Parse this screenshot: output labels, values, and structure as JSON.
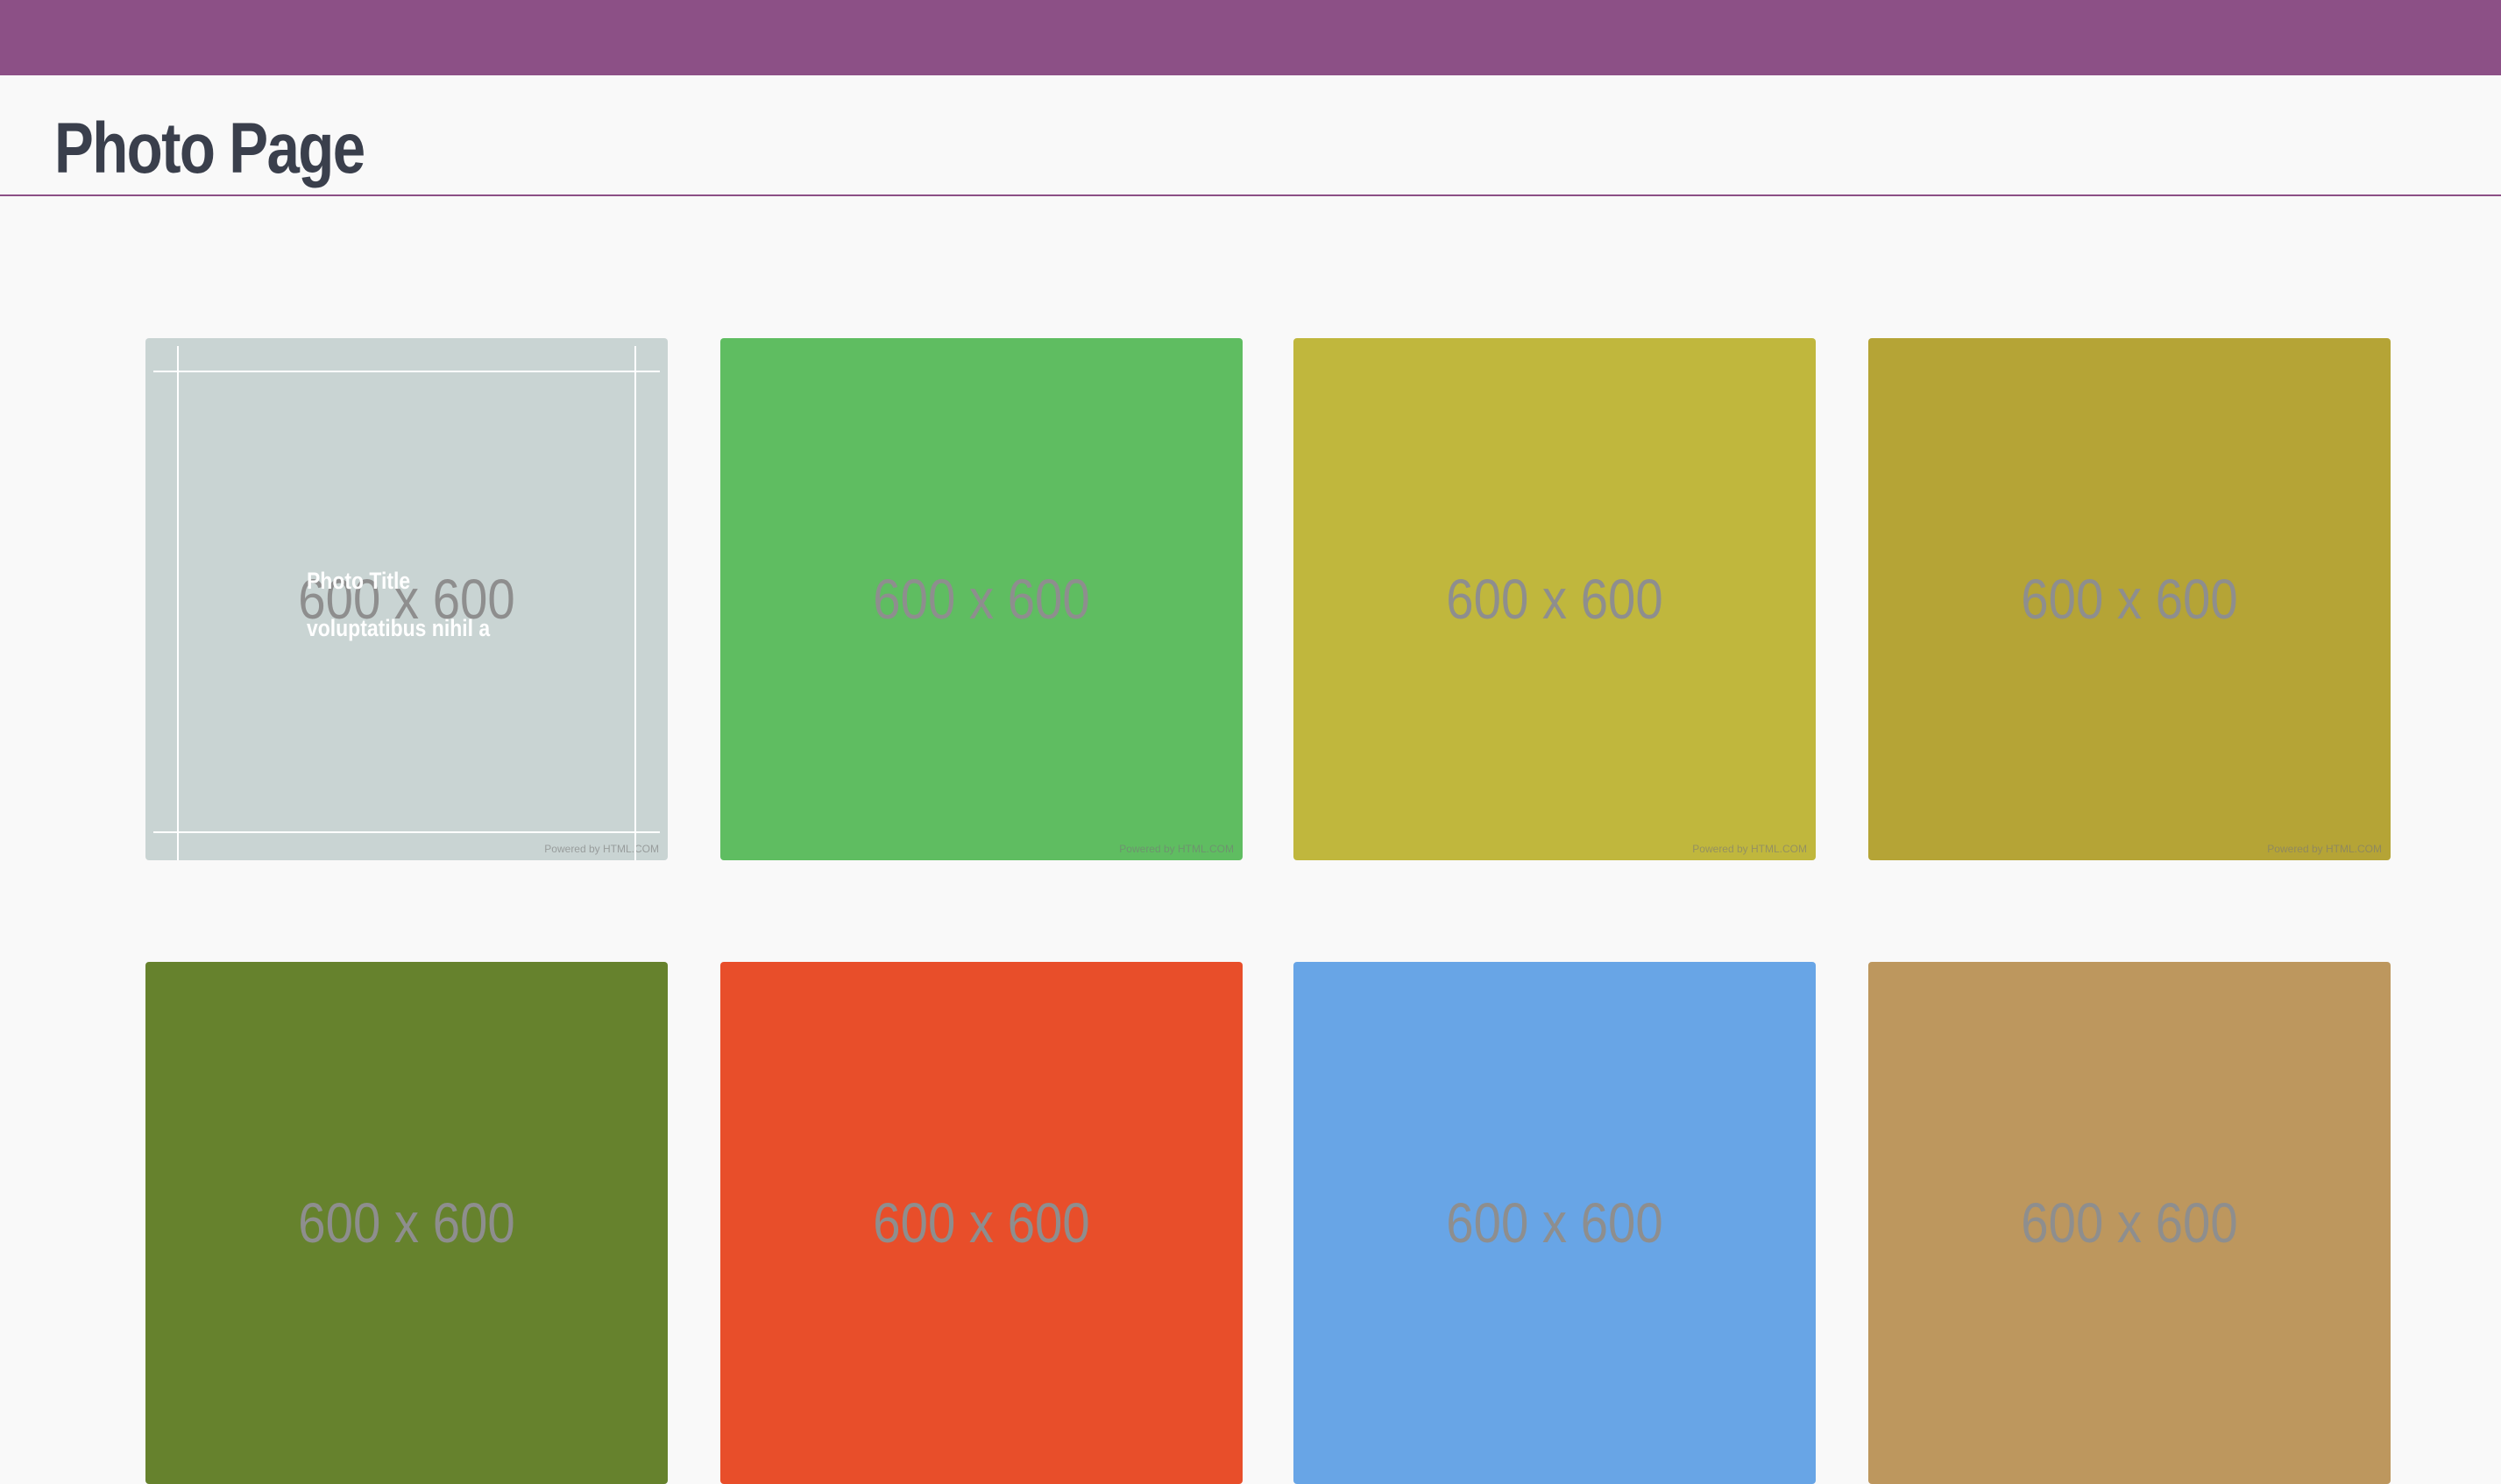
{
  "header": {
    "title": "Photo Page",
    "accent_color": "#8c5086"
  },
  "gallery": {
    "tiles": [
      {
        "label": "600 x 600",
        "color": "#c9d4d3",
        "powered": "Powered by HTML.COM",
        "hovered": true,
        "caption": {
          "title": "Photo Title",
          "text": "voluptatibus nihil a"
        }
      },
      {
        "label": "600 x 600",
        "color": "#5fbd61",
        "powered": "Powered by HTML.COM"
      },
      {
        "label": "600 x 600",
        "color": "#c0b73d",
        "powered": "Powered by HTML.COM"
      },
      {
        "label": "600 x 600",
        "color": "#b5a436",
        "powered": "Powered by HTML.COM"
      },
      {
        "label": "600 x 600",
        "color": "#66822d"
      },
      {
        "label": "600 x 600",
        "color": "#e84e2a"
      },
      {
        "label": "600 x 600",
        "color": "#68a5e6"
      },
      {
        "label": "600 x 600",
        "color": "#bd975e"
      }
    ]
  }
}
